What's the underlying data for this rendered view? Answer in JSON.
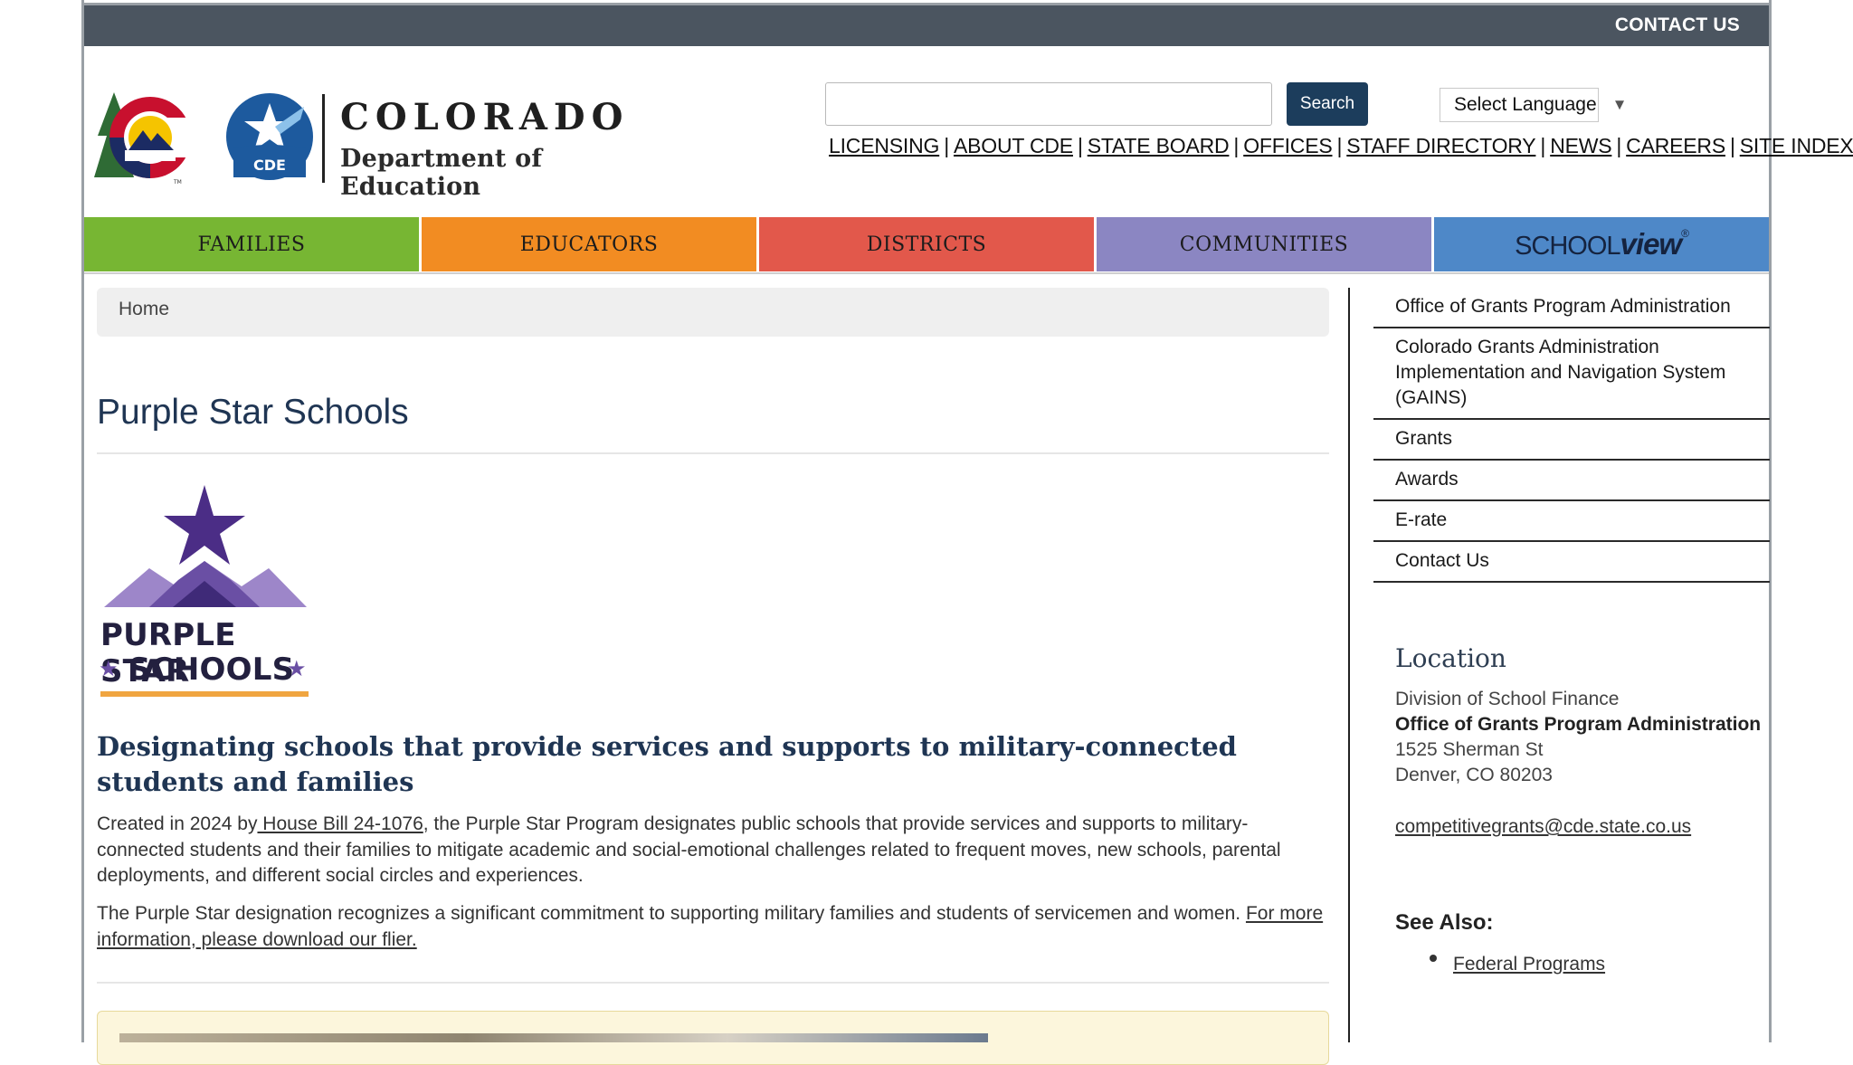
{
  "topbar": {
    "contact": "CONTACT US"
  },
  "header": {
    "logo_title": "COLORADO",
    "logo_subtitle": "Department of Education",
    "logo_badge": "CDE",
    "logo_tm": "TM",
    "search_value": "",
    "search_button": "Search",
    "language_label": "Select Language",
    "language_arrow": "▼",
    "util_links": [
      "LICENSING",
      "ABOUT CDE",
      "STATE BOARD",
      "OFFICES",
      "STAFF DIRECTORY",
      "NEWS",
      "CAREERS",
      "SITE INDEX"
    ],
    "util_sep": "|"
  },
  "nav": {
    "items": [
      {
        "label": "FAMILIES",
        "color": "#77b633"
      },
      {
        "label": "EDUCATORS",
        "color": "#f28c22"
      },
      {
        "label": "DISTRICTS",
        "color": "#e2584b"
      },
      {
        "label": "COMMUNITIES",
        "color": "#8b86c2"
      }
    ],
    "schoolview_a": "SCHOOL",
    "schoolview_b": "view",
    "schoolview_mark": "®",
    "schoolview_color": "#4e88c8"
  },
  "breadcrumb": {
    "home": "Home"
  },
  "main": {
    "title": "Purple Star Schools",
    "badge_line1": "PURPLE STAR",
    "badge_line2": "SCHOOLS",
    "badge_star": "★",
    "subheading": "Designating schools that provide services and supports to military-connected students and families",
    "p1_before": "Created in 2024 by",
    "p1_link": " House Bill 24-1076",
    "p1_after": ", the Purple Star Program designates public schools that provide services and supports to military-connected students and their families to mitigate academic and social-emotional challenges related to frequent moves, new schools, parental deployments, and different social circles and experiences.",
    "p2_text": "The Purple Star designation recognizes a  significant commitment to supporting military families and students of servicemen and women. ",
    "p2_link": "For more information, please download our flier."
  },
  "sidebar": {
    "nav": [
      "Office of Grants Program Administration",
      "Colorado Grants Administration Implementation and Navigation System (GAINS)",
      "Grants",
      "Awards",
      "E-rate",
      "Contact Us"
    ],
    "location_heading": "Location",
    "location": {
      "division": "Division of School Finance",
      "office": "Office of Grants Program Administration",
      "street": "1525 Sherman St",
      "city": "Denver, CO 80203"
    },
    "email": "competitivegrants@cde.state.co.us",
    "see_also_heading": "See Also:",
    "see_also": [
      "Federal Programs"
    ]
  },
  "colors": {
    "topbar": "#4b5560",
    "title": "#1f3553",
    "purple_dark": "#3f2a78",
    "purple_mid": "#6a4fa4",
    "purple_light": "#9d86c9",
    "gold": "#f0a540"
  }
}
